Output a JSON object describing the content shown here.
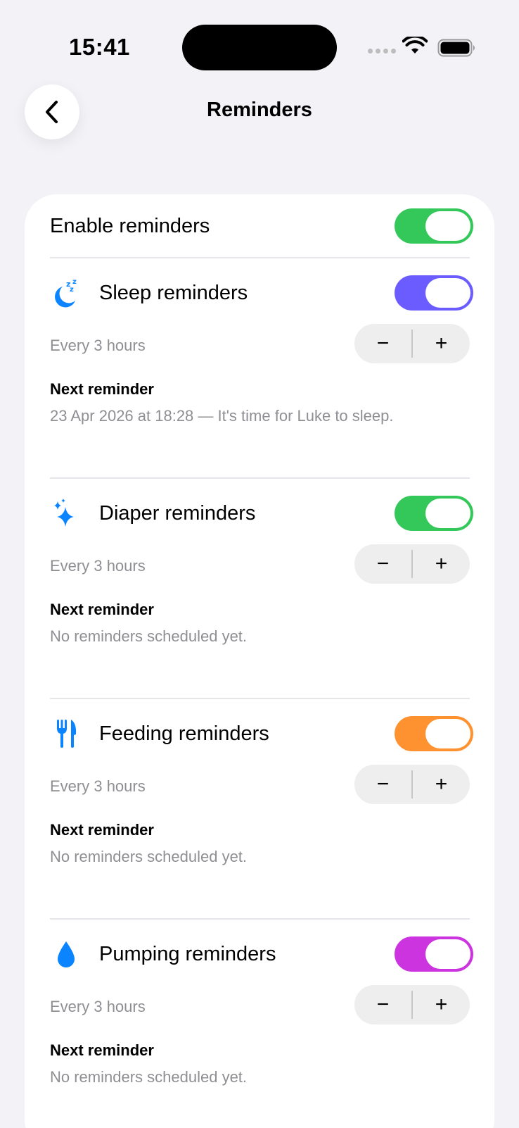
{
  "status": {
    "time": "15:41"
  },
  "nav": {
    "title": "Reminders"
  },
  "enable": {
    "label": "Enable reminders",
    "on": true,
    "color": "#34c759"
  },
  "sections": [
    {
      "title": "Sleep reminders",
      "icon": "moon-zzz-icon",
      "toggle_color": "#6b5cff",
      "frequency": "Every 3 hours",
      "next_label": "Next reminder",
      "next_text": "23 Apr 2026 at 18:28 — It's time for Luke to sleep."
    },
    {
      "title": "Diaper reminders",
      "icon": "sparkles-icon",
      "toggle_color": "#34c759",
      "frequency": "Every 3 hours",
      "next_label": "Next reminder",
      "next_text": "No reminders scheduled yet."
    },
    {
      "title": "Feeding reminders",
      "icon": "fork-knife-icon",
      "toggle_color": "#ff9230",
      "frequency": "Every 3 hours",
      "next_label": "Next reminder",
      "next_text": "No reminders scheduled yet."
    },
    {
      "title": "Pumping reminders",
      "icon": "drop-icon",
      "toggle_color": "#cc34e0",
      "frequency": "Every 3 hours",
      "next_label": "Next reminder",
      "next_text": "No reminders scheduled yet."
    }
  ],
  "stepper": {
    "minus": "−",
    "plus": "+"
  },
  "colors": {
    "icon_blue": "#0a84ff",
    "secondary_text": "#8e8e93"
  }
}
